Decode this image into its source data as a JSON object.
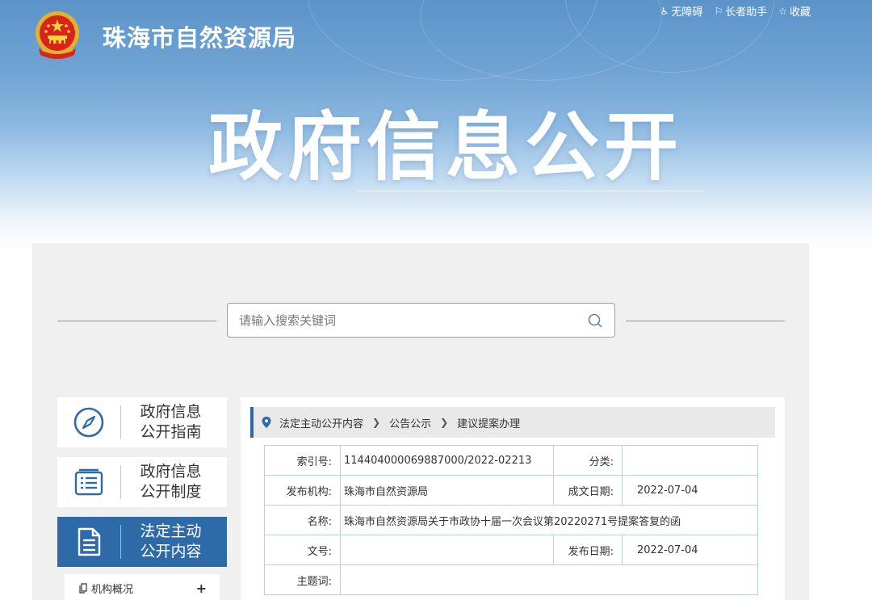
{
  "header": {
    "site_name": "珠海市自然资源局",
    "big_title": "政府信息公开",
    "top_links": [
      {
        "label": "无障碍",
        "icon": "accessibility-icon"
      },
      {
        "label": "长者助手",
        "icon": "elder-helper-icon"
      },
      {
        "label": "收藏",
        "icon": "star-icon"
      }
    ]
  },
  "search": {
    "placeholder": "请输入搜索关键词"
  },
  "sidebar": {
    "items": [
      {
        "label": "政府信息\n公开指南",
        "icon": "compass-icon",
        "active": false
      },
      {
        "label": "政府信息\n公开制度",
        "icon": "list-document-icon",
        "active": false
      },
      {
        "label": "法定主动\n公开内容",
        "icon": "document-icon",
        "active": true
      }
    ],
    "sub_items": [
      {
        "label": "机构概况",
        "toggle": "+"
      }
    ]
  },
  "breadcrumb": [
    "法定主动公开内容",
    "公告公示",
    "建议提案办理"
  ],
  "info": {
    "index_label": "索引号:",
    "index_value": "114404000069887000/2022-02213",
    "category_label": "分类:",
    "category_value": "",
    "publisher_label": "发布机构:",
    "publisher_value": "珠海市自然资源局",
    "written_date_label": "成文日期:",
    "written_date_value": "2022-07-04",
    "name_label": "名称:",
    "name_value": "珠海市自然资源局关于市政协十届一次会议第20220271号提案答复的函",
    "docno_label": "文号:",
    "docno_value": "",
    "publish_date_label": "发布日期:",
    "publish_date_value": "2022-07-04",
    "subject_label": "主题词:",
    "subject_value": ""
  },
  "colors": {
    "accent": "#2f6aa8",
    "banner_top": "#5c94c9",
    "panel_bg": "#f0f0f0",
    "table_border": "#b9cfe4"
  }
}
